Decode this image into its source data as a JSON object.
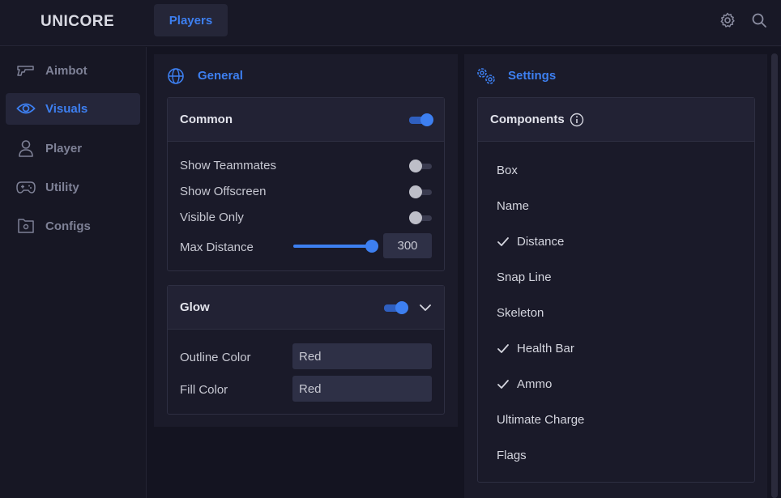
{
  "app": {
    "brand": "UNICORE"
  },
  "topbar": {
    "active_tab": "Players",
    "icons": [
      "gear-icon",
      "search-icon"
    ]
  },
  "sidebar": {
    "items": [
      {
        "label": "Aimbot",
        "icon": "gun-icon",
        "active": false
      },
      {
        "label": "Visuals",
        "icon": "eye-icon",
        "active": true
      },
      {
        "label": "Player",
        "icon": "user-icon",
        "active": false
      },
      {
        "label": "Utility",
        "icon": "gamepad-icon",
        "active": false
      },
      {
        "label": "Configs",
        "icon": "folder-gear-icon",
        "active": false
      }
    ]
  },
  "general": {
    "title": "General",
    "icon": "globe-icon",
    "common": {
      "title": "Common",
      "enabled": true,
      "rows": [
        {
          "label": "Show Teammates",
          "on": false
        },
        {
          "label": "Show Offscreen",
          "on": false
        },
        {
          "label": "Visible Only",
          "on": false
        }
      ],
      "max_distance": {
        "label": "Max Distance",
        "value": "300",
        "fraction": 1.0
      }
    },
    "glow": {
      "title": "Glow",
      "enabled": true,
      "outline_color": {
        "label": "Outline Color",
        "value": "Red"
      },
      "fill_color": {
        "label": "Fill Color",
        "value": "Red"
      }
    }
  },
  "settings": {
    "title": "Settings",
    "icon": "gears-icon",
    "components": {
      "title": "Components",
      "info_icon": "info-icon",
      "items": [
        {
          "label": "Box",
          "checked": false
        },
        {
          "label": "Name",
          "checked": false
        },
        {
          "label": "Distance",
          "checked": true
        },
        {
          "label": "Snap Line",
          "checked": false
        },
        {
          "label": "Skeleton",
          "checked": false
        },
        {
          "label": "Health Bar",
          "checked": true
        },
        {
          "label": "Ammo",
          "checked": true
        },
        {
          "label": "Ultimate Charge",
          "checked": false
        },
        {
          "label": "Flags",
          "checked": false
        }
      ]
    }
  },
  "colors": {
    "accent": "#3d7ff0",
    "background": "#161622",
    "panel": "#1b1b2a"
  }
}
